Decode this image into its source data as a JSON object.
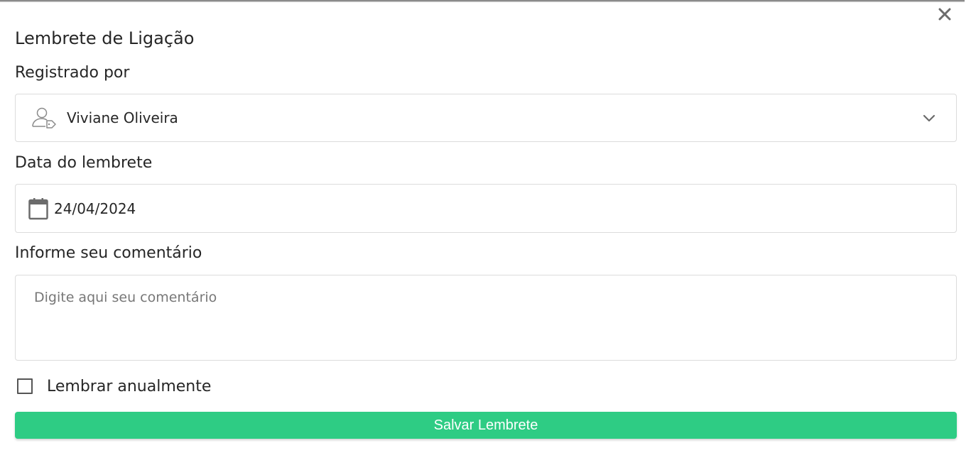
{
  "modal": {
    "title": "Lembrete de Ligação",
    "close_icon": "close-icon"
  },
  "form": {
    "registered_by": {
      "label": "Registrado por",
      "value": "Viviane Oliveira",
      "icon": "user-tag-icon"
    },
    "reminder_date": {
      "label": "Data do lembrete",
      "value": "24/04/2024",
      "icon": "calendar-icon"
    },
    "comment": {
      "label": "Informe seu comentário",
      "placeholder": "Digite aqui seu comentário",
      "value": ""
    },
    "yearly": {
      "label": "Lembrar anualmente",
      "checked": false
    },
    "save_label": "Salvar Lembrete"
  },
  "colors": {
    "accent": "#2ecc84",
    "text": "#262626",
    "border": "#dcdcdc"
  }
}
